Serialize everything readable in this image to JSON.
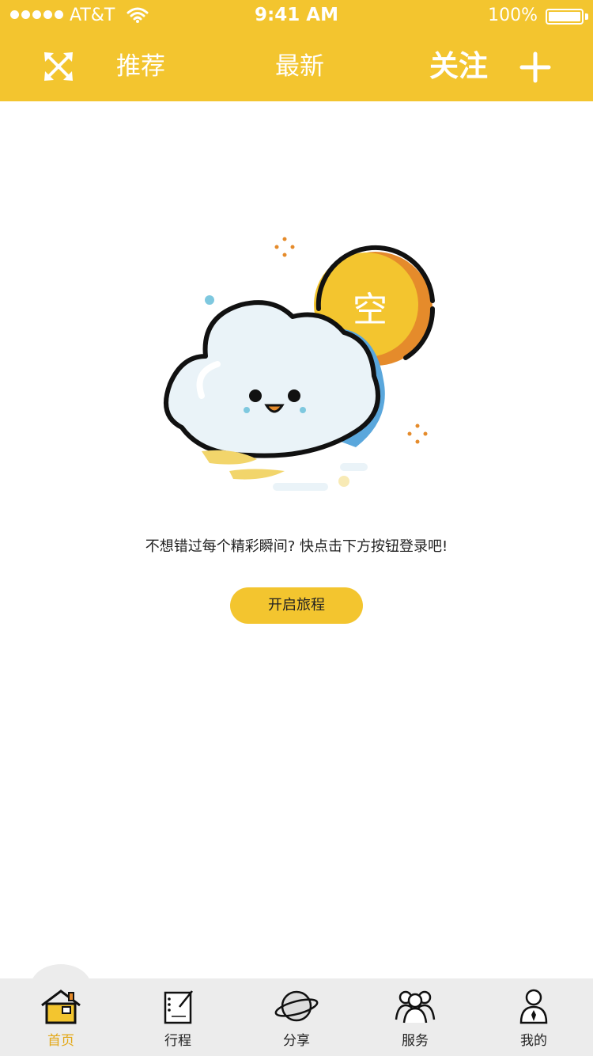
{
  "status_bar": {
    "carrier": "AT&T",
    "time": "9:41 AM",
    "battery": "100%"
  },
  "nav": {
    "expand_icon": "expand-arrows-icon",
    "tabs": [
      "推荐",
      "最新",
      "关注"
    ],
    "active_tab": "关注",
    "plus_icon": "plus-icon"
  },
  "empty_state": {
    "illustration_label": "空",
    "message": "不想错过每个精彩瞬间? 快点击下方按钮登录吧!",
    "button_label": "开启旅程"
  },
  "tabbar": {
    "items": [
      {
        "label": "首页",
        "icon": "home-icon",
        "active": true
      },
      {
        "label": "行程",
        "icon": "notebook-icon",
        "active": false
      },
      {
        "label": "分享",
        "icon": "planet-icon",
        "active": false
      },
      {
        "label": "服务",
        "icon": "group-icon",
        "active": false
      },
      {
        "label": "我的",
        "icon": "user-icon",
        "active": false
      }
    ]
  },
  "colors": {
    "primary": "#F3C52F",
    "active_label": "#E3A817",
    "tabbar_bg": "#ECECEC"
  }
}
